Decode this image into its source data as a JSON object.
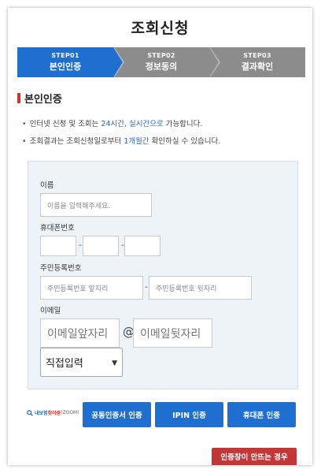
{
  "page": {
    "title": "조회신청"
  },
  "steps": [
    {
      "num": "STEP01",
      "name": "본인인증",
      "active": true
    },
    {
      "num": "STEP02",
      "name": "정보동의",
      "active": false
    },
    {
      "num": "STEP03",
      "name": "결과확인",
      "active": false
    }
  ],
  "section": {
    "title": "본인인증"
  },
  "notes": {
    "line1_prefix": "인터넷 신청 및 조회는 ",
    "line1_hl1": "24시간",
    "line1_mid": ", ",
    "line1_hl2": "실시간으로",
    "line1_suffix": " 가능합니다.",
    "line2_prefix": "조회결과는 조회신청일로부터 ",
    "line2_hl": "1개월간",
    "line2_suffix": " 확인하실 수 있습니다."
  },
  "form": {
    "name_label": "이름",
    "name_placeholder": "이름을 입력해주세요.",
    "phone_label": "휴대폰번호",
    "phone_part1": "",
    "phone_part2": "",
    "phone_part3": "",
    "phone_sep": "-",
    "rrn_label": "주민등록번호",
    "rrn_front_placeholder": "주민등록번호 앞자리",
    "rrn_back_placeholder": "주민등록번호 뒷자리",
    "rrn_sep": "-",
    "email_label": "이메일",
    "email_front_placeholder": "이메일앞자리",
    "email_at": "@",
    "email_back_placeholder": "이메일뒷자리",
    "email_domain_selected": "직접입력"
  },
  "zoom_logo": {
    "prefix": "내보험",
    "brand": "찾아줌",
    "suffix": "(ZOOM)"
  },
  "buttons": {
    "cert": "공동인증서 인증",
    "ipin": "IPIN 인증",
    "phone": "휴대폰 인증",
    "trouble": "인증창이 안뜨는 경우"
  },
  "colors": {
    "primary": "#1f6fd1",
    "inactive_step": "#8c8c8c",
    "accent_red": "#c23838"
  }
}
